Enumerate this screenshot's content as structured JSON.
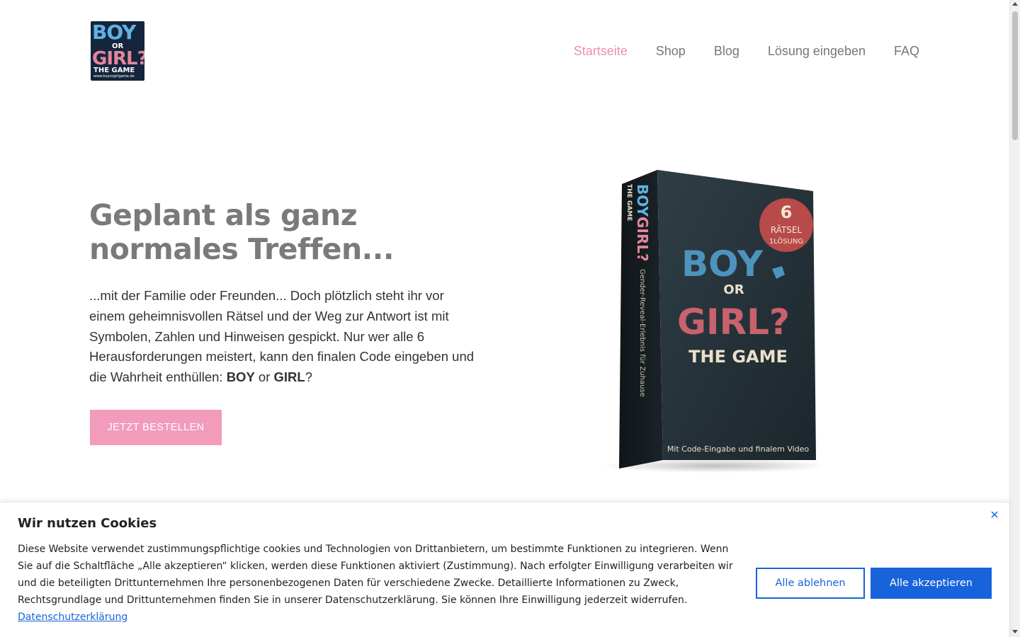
{
  "logo": {
    "line1": "BOY",
    "line2": "OR",
    "line3": "GIRL?",
    "line4": "THE GAME",
    "line5": "www.boyorgirlgame.de"
  },
  "nav": {
    "items": [
      {
        "label": "Startseite",
        "active": true
      },
      {
        "label": "Shop",
        "active": false
      },
      {
        "label": "Blog",
        "active": false
      },
      {
        "label": "Lösung eingeben",
        "active": false
      },
      {
        "label": "FAQ",
        "active": false
      }
    ]
  },
  "hero": {
    "title": "Geplant als ganz normales Treffen...",
    "text_before": "...mit der Familie oder Freunden... Doch plötzlich steht ihr vor einem geheimnisvollen Rätsel und der Weg zur Antwort ist mit Symbolen, Zahlen und Hinweisen gespickt. Nur wer alle 6 Herausforderungen meistert, kann den finalen Code eingeben und die Wahrheit enthüllen: ",
    "text_boy": "BOY",
    "text_or": " or ",
    "text_girl": "GIRL",
    "text_after": "?",
    "cta_label": "JETZT BESTELLEN"
  },
  "product": {
    "badge_number": "6",
    "badge_line1": "RÄTSEL",
    "badge_line2": "1LÖSUNG",
    "front_boy": "BOY",
    "front_or": "OR",
    "front_girl": "GIRL?",
    "front_game": "THE GAME",
    "front_footer": "Mit Code-Eingabe und finalem Video",
    "spine_boy": "BOY",
    "spine_girl": "GIRL?",
    "spine_game": "THE GAME",
    "spine_text": "Gender-Reveal-Erlebnis für Zuhause"
  },
  "cookie": {
    "title": "Wir nutzen Cookies",
    "text": "Diese Website verwendet zustimmungspflichtige cookies und Technologien von Drittanbietern, um bestimmte Funktionen zu integrieren. Wenn Sie auf die Schaltfläche „Alle akzeptieren“ klicken, werden diese Funktionen aktiviert (Zustimmung). Nach erfolgter Einwilligung verarbeiten wir und die beteiligten Drittunternehmen Ihre personenbezogenen Daten für verschiedene Zwecke. Detaillierte Informationen zu Zweck, Rechtsgrundlage und Drittunternehmen finden Sie in unserer Datenschutzerklärung. Sie können Ihre Einwilligung jederzeit widerrufen. ",
    "link_label": "Datenschutzerklärung",
    "reject_label": "Alle ablehnen",
    "accept_label": "Alle akzeptieren",
    "close_icon": "close-icon"
  },
  "colors": {
    "accent_pink": "#ec8fb3",
    "cta_pink": "#f29bbb",
    "cookie_blue": "#1863dc",
    "heading_gray": "#7a7a7a"
  }
}
